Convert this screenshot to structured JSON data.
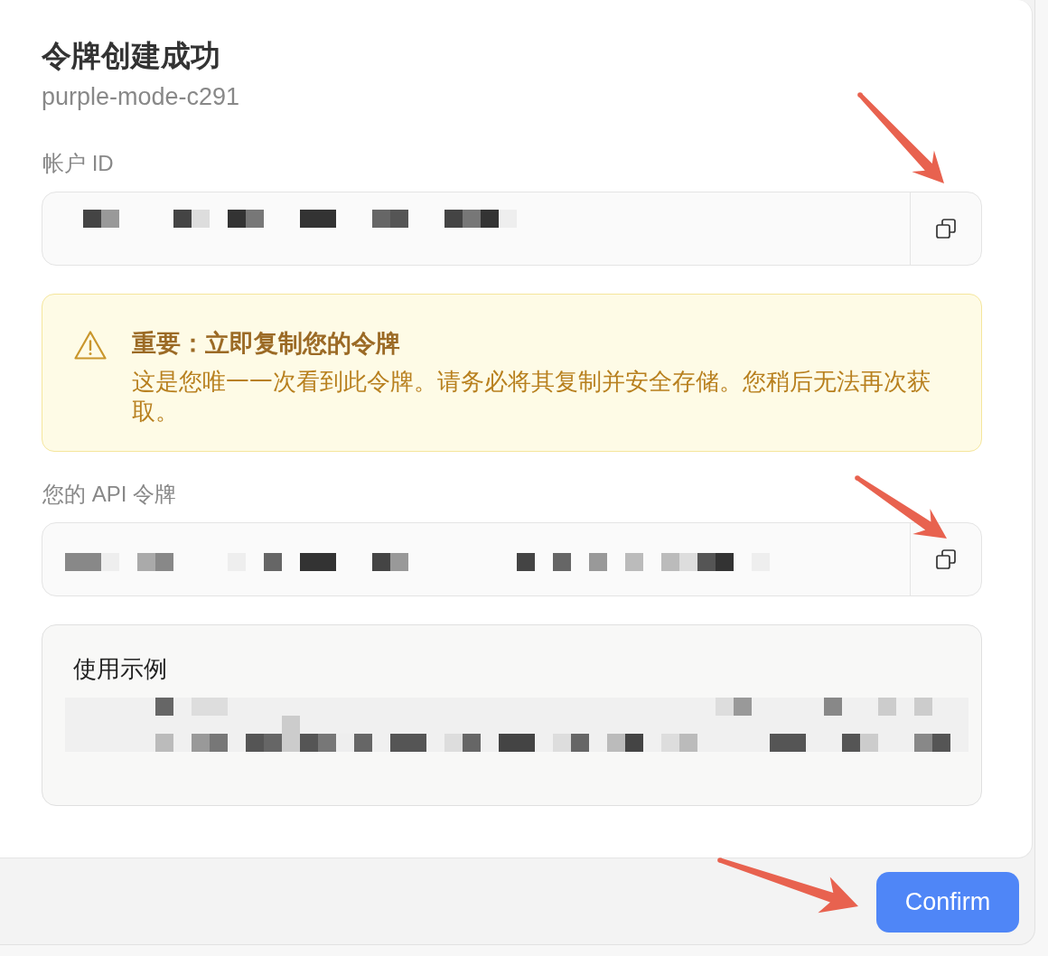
{
  "dialog": {
    "title": "令牌创建成功",
    "subtitle": "purple-mode-c291"
  },
  "sections": [
    {
      "kind": "field",
      "label": "帐户 ID",
      "redacted": true,
      "copy_annotated": true
    },
    {
      "kind": "warning",
      "title": "重要：立即复制您的令牌",
      "message": "这是您唯一一次看到此令牌。请务必将其复制并安全存储。您稍后无法再次获取。"
    },
    {
      "kind": "field",
      "label": "您的 API 令牌",
      "redacted": true,
      "copy_annotated": true
    },
    {
      "kind": "example",
      "title": "使用示例",
      "redacted": true
    }
  ],
  "footer": {
    "confirm_button": {
      "label": "Confirm",
      "annotated": true
    }
  }
}
